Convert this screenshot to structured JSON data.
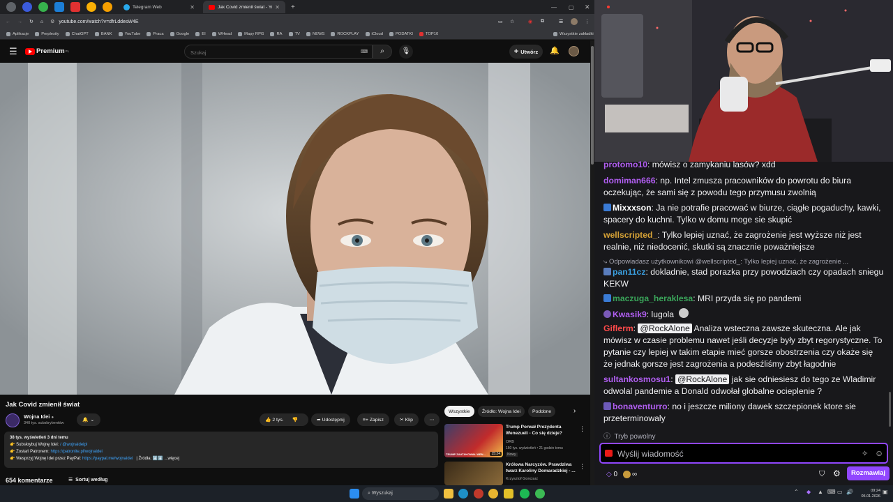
{
  "browser": {
    "tabs": [
      {
        "label": "Telegram Web"
      },
      {
        "label": "Jak Covid zmienił świat - Yo"
      }
    ],
    "url": "youtube.com/watch?v=dfrLddesW4E",
    "bookmarks": [
      "Aplikacje",
      "Perplexity",
      "ChatGPT",
      "BANK",
      "YouTube",
      "Praca",
      "Google",
      "EI",
      "WHead",
      "Mapy RPG",
      "RA",
      "TV",
      "NEWS",
      "ROCKPLAY",
      "iCloud",
      "PODATKI",
      "TOP10"
    ],
    "all_bookmarks": "Wszystkie zakładki"
  },
  "youtube": {
    "logo_text": "Premium",
    "logo_sup": "PL",
    "search_placeholder": "Szukaj",
    "create_label": "Utwórz",
    "video": {
      "title": "Jak Covid zmienił świat",
      "channel": "Wojna Idei",
      "subscribers": "340 tys. subskrybentów",
      "likes": "2 tys.",
      "share": "Udostępnij",
      "save": "Zapisz",
      "clip": "Klip"
    },
    "description": {
      "stats": "38 tys. wyświetleń  3 dni temu",
      "line1_prefix": "👉 Subskrybuj Wojnę Idei:",
      "line1_link": "/ @wojnaideipl",
      "line2_prefix": "👉 Zostań Patronem:",
      "line2_link": "https://patronite.pl/wojnaidei",
      "line3_prefix": "👉 Wesprzyj Wojnę Idei przez PayPal:",
      "line3_link": "https://paypal.me/wojnaidei",
      "line3_suffix": "|   Źródła: ⬇️⬇️ ...więcej"
    },
    "comments": {
      "count": "654 komentarze",
      "sort": "Sortuj według"
    },
    "chips": [
      "Wszystkie",
      "Źródło: Wojna Idei",
      "Podobne"
    ],
    "recommended": [
      {
        "title": "Trump Porwał Prezydenta Wenezueli - Co się dzieje?",
        "channel": "ORB",
        "meta": "160 tys. wyświetleń • 21 godzin temu",
        "badge": "Nowy",
        "duration": "15:24",
        "thumb_text": "TRUMP ZAATAKOWAŁ WEN..."
      },
      {
        "title": "Królowa Narcyzów. Prawdziwa twarz Karoliny Domaradzkiej - ...",
        "channel": "Krzysztof Gonciarz",
        "meta": "",
        "badge": "",
        "duration": "",
        "thumb_text": ""
      }
    ]
  },
  "chat": {
    "messages": [
      {
        "user": "protomo10",
        "color": "#b05ef0",
        "text": ": mówisz o zamykaniu lasów? xdd"
      },
      {
        "user": "domiman666",
        "color": "#b05ef0",
        "text": ": np. Intel zmusza pracowników do powrotu do biura oczekując, że sami się z powodu tego przymusu zwolnią"
      },
      {
        "user": "Mixxxson",
        "color": "#ffffff",
        "text": ": Ja nie potrafie pracować w biurze, ciągłe pogaduchy, kawki, spacery do kuchni. Tylko w domu moge sie skupić"
      },
      {
        "user": "wellscripted_",
        "color": "#d6a236",
        "text": ": Tylko lepiej uznać, że zagrożenie jest wyższe niż jest realnie, niż niedocenić, skutki są znacznie poważniejsze"
      },
      {
        "user": "pan11cz",
        "color": "#3a9fe0",
        "text": ": dokladnie, stad porazka przy powodziach czy opadach sniegu KEKW"
      },
      {
        "user": "maczuga_heraklesa",
        "color": "#3aa55a",
        "text": ": MRI przyda się po pandemi"
      },
      {
        "user": "Kwasik9",
        "color": "#b05ef0",
        "text": ": lugola"
      },
      {
        "user": "Giflerm",
        "color": "#ff4a4a",
        "mention": "@RockAlone",
        "text": " Analiza wsteczna zawsze skuteczna. Ale jak mówisz w czasie problemu nawet jeśli decyzje były zbyt regorystyczne. To pytanie czy lepiej w takim etapie mieć gorsze obostrzenia czy okaże się że jednak gorsze jest zagrożenia a podesźliśmy zbyt łagodnie"
      },
      {
        "user": "sultankosmosu1",
        "color": "#b05ef0",
        "mention": "@RockAlone",
        "text": " jak sie odniesiesz do tego ze Wladimir odwolal pandemie a Donald odwołał globalne ocieplenie ?"
      },
      {
        "user": "bonaventurro",
        "color": "#b05ef0",
        "text": ": no i jeszcze miliony dawek szczepionek ktore sie przeterminowaly"
      }
    ],
    "reply_note": "Odpowiadasz użytkownikowi @wellscripted_: Tylko lepiej uznać, że zagrożenie ...",
    "slow_mode": "Tryb powolny",
    "input_placeholder": "Wyślij wiadomość",
    "points": "0",
    "send_label": "Rozmawiaj"
  },
  "taskbar": {
    "search": "Wyszukaj",
    "time": "09:24",
    "date": "05.01.2026"
  }
}
